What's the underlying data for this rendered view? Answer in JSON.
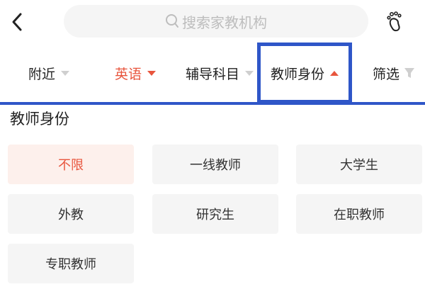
{
  "header": {
    "back_icon": "chevron-left-icon",
    "search": {
      "icon": "search-icon",
      "placeholder": "搜索家教机构"
    },
    "footprint_icon": "footprint-icon"
  },
  "filters": {
    "tabs": [
      {
        "label": "附近",
        "state": "default"
      },
      {
        "label": "英语",
        "state": "selected"
      },
      {
        "label": "辅导科目",
        "state": "default"
      },
      {
        "label": "教师身份",
        "state": "open"
      },
      {
        "label": "筛选",
        "state": "default",
        "icon": "funnel-icon"
      }
    ],
    "accent_color": "#e8553d",
    "highlight_color": "#2f56c8"
  },
  "panel": {
    "title": "教师身份",
    "options": [
      {
        "label": "不限",
        "selected": true
      },
      {
        "label": "一线教师",
        "selected": false
      },
      {
        "label": "大学生",
        "selected": false
      },
      {
        "label": "外教",
        "selected": false
      },
      {
        "label": "研究生",
        "selected": false
      },
      {
        "label": "在职教师",
        "selected": false
      },
      {
        "label": "专职教师",
        "selected": false
      }
    ]
  }
}
